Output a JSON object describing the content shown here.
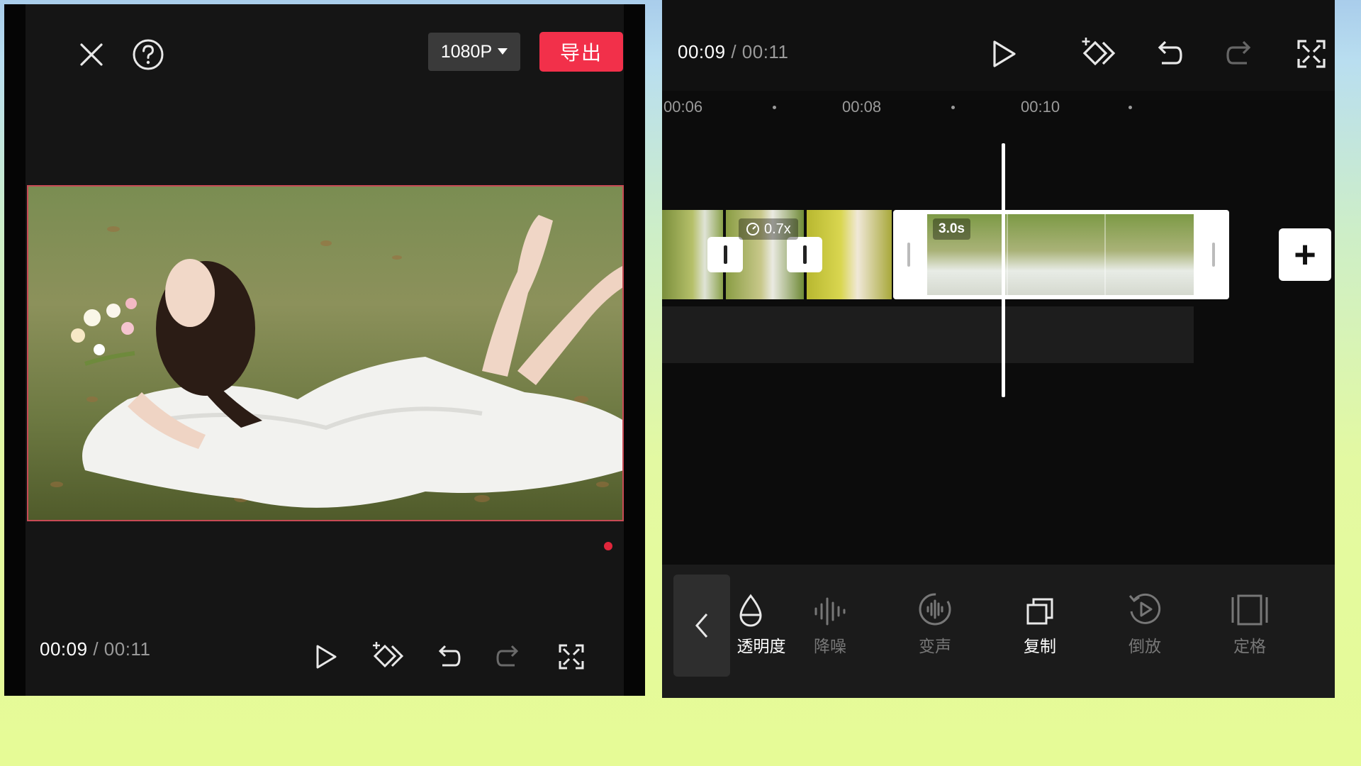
{
  "left_panel": {
    "resolution_label": "1080P",
    "export_label": "导出",
    "time_current": "00:09",
    "time_separator": "/",
    "time_total": "00:11",
    "icons": [
      "close-icon",
      "help-icon",
      "play-icon",
      "keyframe-icon",
      "undo-icon",
      "redo-icon",
      "fullscreen-icon"
    ]
  },
  "right_panel": {
    "time_current": "00:09",
    "time_separator": "/",
    "time_total": "00:11",
    "ruler_ticks": [
      "00:06",
      "00:08",
      "00:10"
    ],
    "clips": {
      "speed_label": "0.7x",
      "duration_label": "3.0s"
    },
    "toolbar": {
      "items": [
        {
          "label": "透明度",
          "icon": "opacity-drop-icon",
          "active": true
        },
        {
          "label": "降噪",
          "icon": "noise-reduction-icon",
          "active": false
        },
        {
          "label": "变声",
          "icon": "voice-change-icon",
          "active": false
        },
        {
          "label": "复制",
          "icon": "copy-icon",
          "active": true
        },
        {
          "label": "倒放",
          "icon": "reverse-play-icon",
          "active": false
        },
        {
          "label": "定格",
          "icon": "freeze-frame-icon",
          "active": false
        }
      ]
    }
  },
  "colors": {
    "accent_red": "#f2304a",
    "panel_bg": "#151515",
    "selection_border": "#c74b55"
  }
}
